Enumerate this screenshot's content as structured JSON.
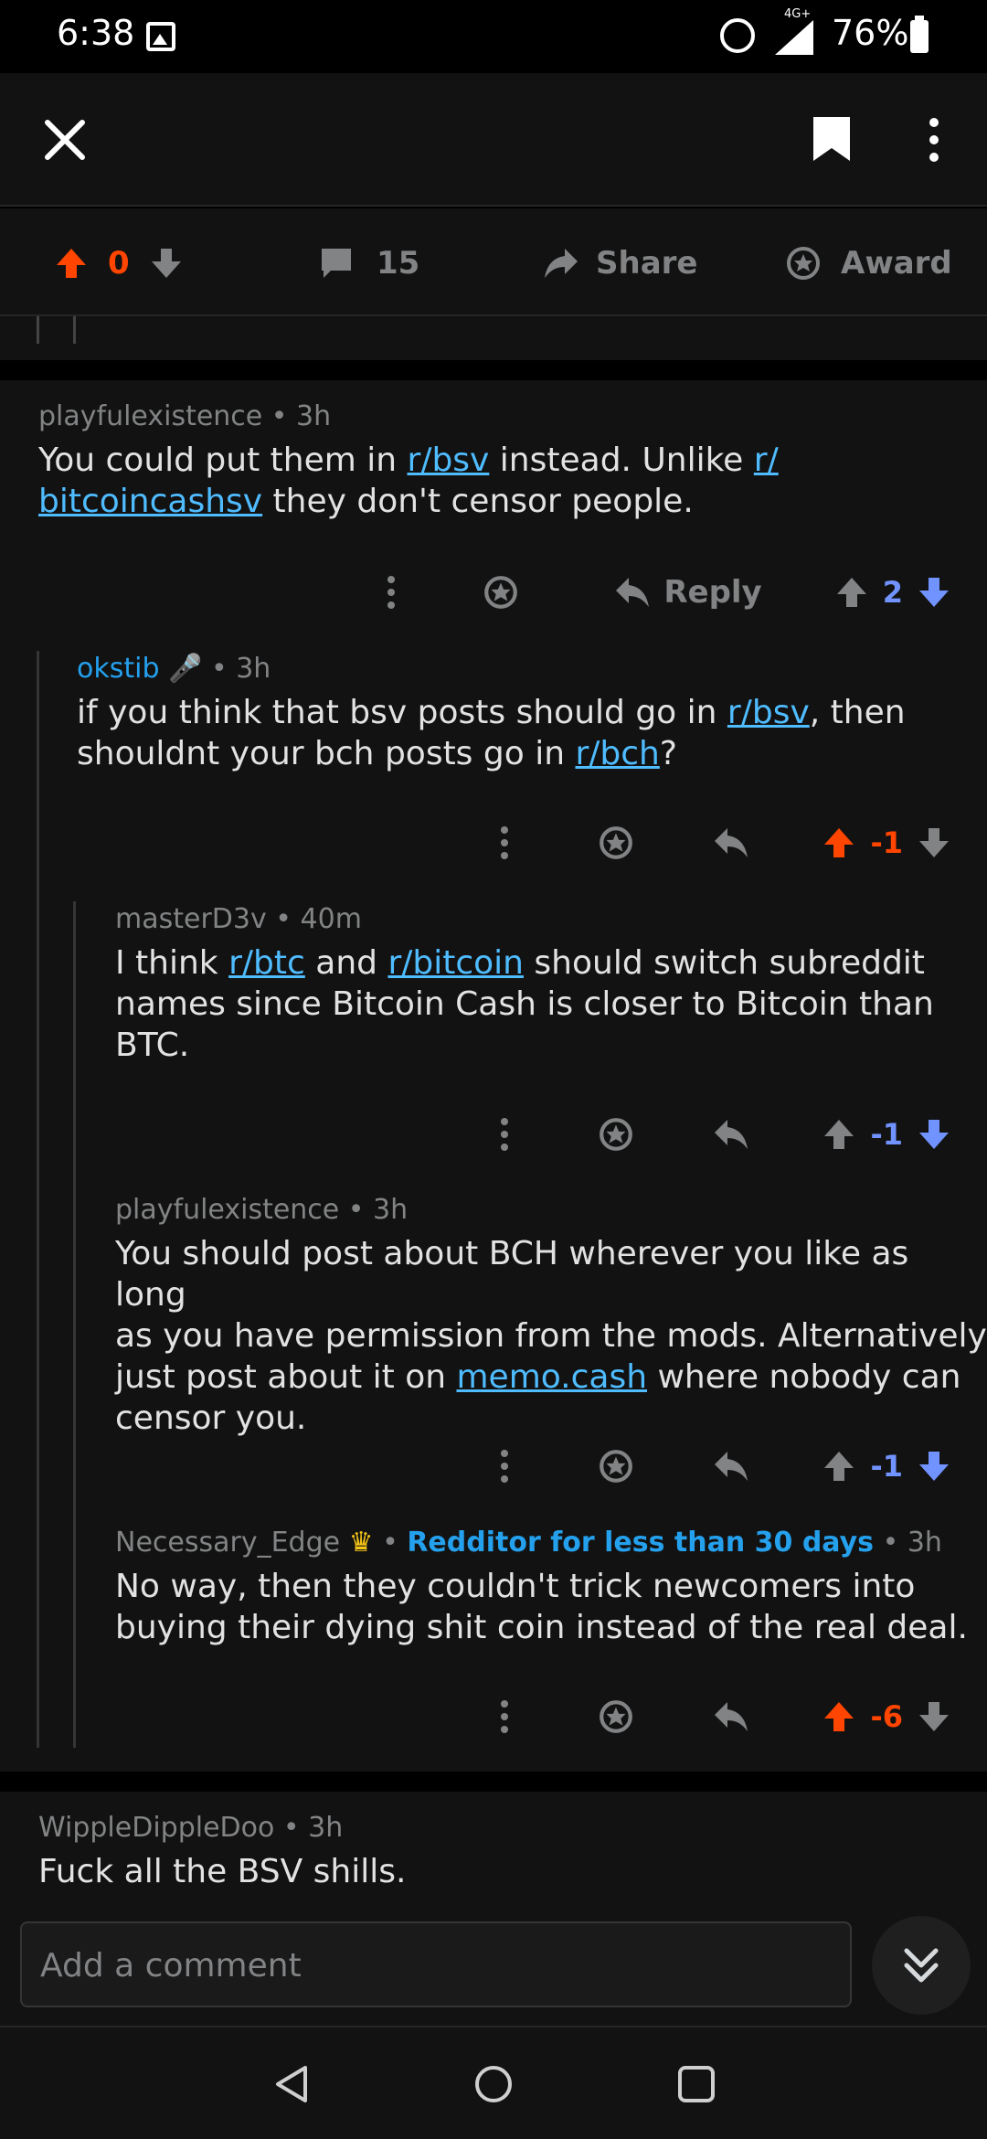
{
  "status_bar": {
    "time": "6:38",
    "network": "4G+",
    "battery": "76%"
  },
  "post_bar": {
    "score": "0",
    "comments": "15",
    "share_label": "Share",
    "award_label": "Award"
  },
  "comments": [
    {
      "user": "playfulexistence",
      "time": "3h",
      "body_parts": [
        "You could put them in ",
        "r/bsv",
        " instead. Unlike ",
        "r/",
        "bitcoincashsv",
        " they don't censor people."
      ],
      "reply_label": "Reply",
      "score": "2",
      "score_color": "#7193ff"
    },
    {
      "user": "okstib",
      "time": "3h",
      "body_parts": [
        "if you think that bsv posts should go in ",
        "r/bsv",
        ", then",
        "shouldnt your bch posts go in ",
        "r/bch",
        "?"
      ],
      "score": "-1",
      "score_color": "#ff4500"
    },
    {
      "user": "masterD3v",
      "time": "40m",
      "body_parts": [
        "I think ",
        "r/btc",
        " and ",
        "r/bitcoin",
        " should switch subreddit",
        "names since Bitcoin Cash is closer to Bitcoin than",
        "BTC."
      ],
      "score": "-1",
      "score_color": "#7193ff"
    },
    {
      "user": "playfulexistence",
      "time": "3h",
      "body_parts": [
        "You should post about BCH wherever you like as long",
        "as you have permission from the mods. Alternatively",
        "just post about it on ",
        "memo.cash",
        " where nobody can",
        "censor you."
      ],
      "score": "-1",
      "score_color": "#7193ff"
    },
    {
      "user": "Necessary_Edge",
      "flair": "Redditor for less than 30 days",
      "time": "3h",
      "body_parts": [
        "No way, then they couldn't trick newcomers into",
        "buying their dying shit coin instead of the real deal."
      ],
      "score": "-6",
      "score_color": "#ff4500"
    },
    {
      "user": "WippleDippleDoo",
      "time": "3h",
      "body": "Fuck all the BSV shills."
    }
  ],
  "add_comment": {
    "placeholder": "Add a comment"
  },
  "colors": {
    "upvote": "#ff4500",
    "downvote": "#7193ff",
    "link": "#4fbcff",
    "background": "#121212"
  },
  "icons": [
    "close-icon",
    "bookmark-icon",
    "more-icon",
    "upvote-icon",
    "downvote-icon",
    "comment-icon",
    "share-icon",
    "award-icon",
    "reply-icon",
    "jump-down-icon",
    "back-nav-icon",
    "home-nav-icon",
    "recents-nav-icon"
  ]
}
